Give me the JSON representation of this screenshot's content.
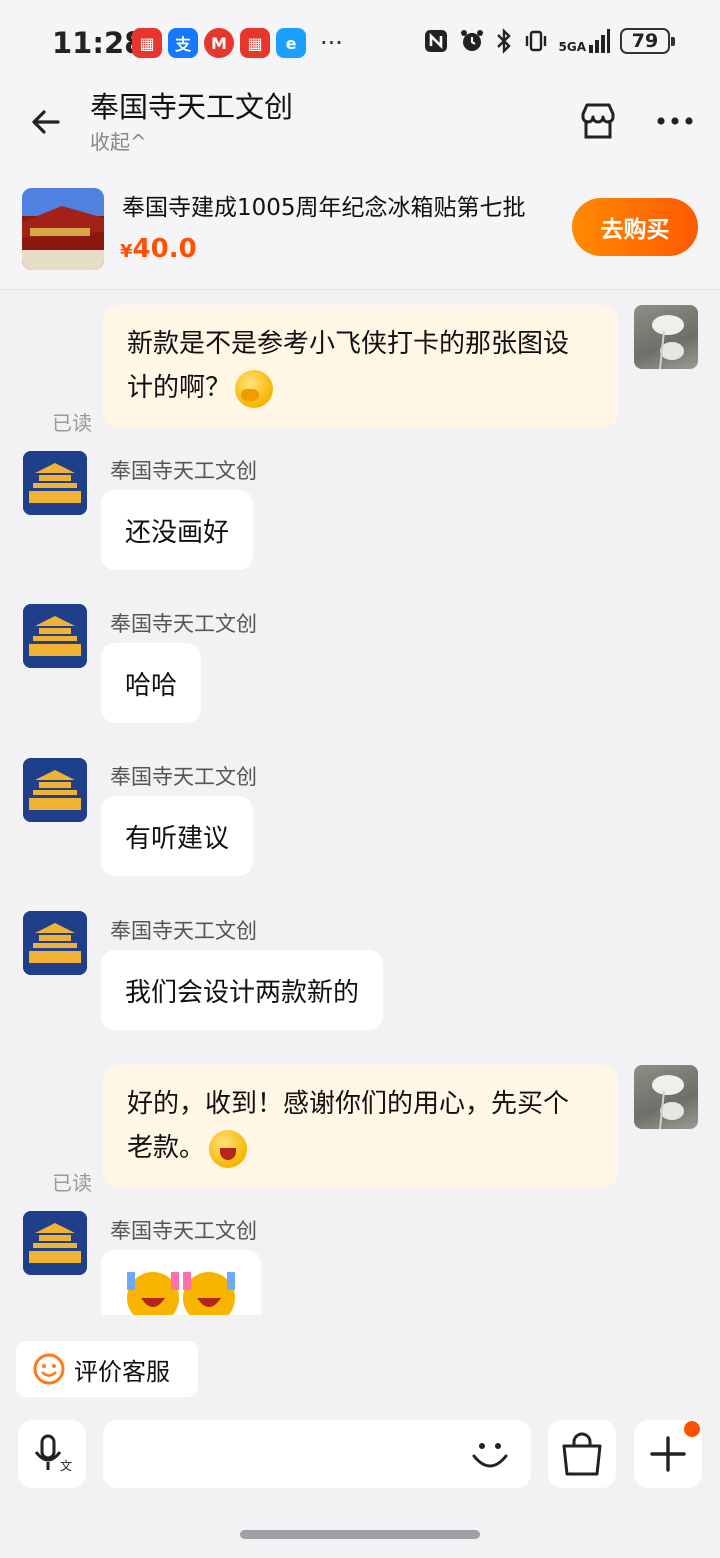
{
  "status": {
    "time": "11:28",
    "network": "5GA",
    "battery": "79",
    "more": "···"
  },
  "header": {
    "title": "奉国寺天工文创",
    "collapse": "收起^"
  },
  "product": {
    "name": "奉国寺建成1005周年纪念冰箱贴第七批",
    "currency": "¥",
    "price": "40.0",
    "buy": "去购买"
  },
  "messages": [
    {
      "from": "user",
      "text": "新款是不是参考小飞侠打卡的那张图设计的啊？",
      "read": "已读"
    },
    {
      "from": "shop",
      "sender": "奉国寺天工文创",
      "text": "还没画好"
    },
    {
      "from": "shop",
      "sender": "奉国寺天工文创",
      "text": "哈哈"
    },
    {
      "from": "shop",
      "sender": "奉国寺天工文创",
      "text": "有听建议"
    },
    {
      "from": "shop",
      "sender": "奉国寺天工文创",
      "text": "我们会设计两款新的"
    },
    {
      "from": "user",
      "text": "好的，收到！感谢你们的用心，先买个老款。",
      "read": "已读"
    },
    {
      "from": "shop",
      "sender": "奉国寺天工文创",
      "text": ""
    }
  ],
  "bottom": {
    "rate": "评价客服"
  },
  "colors": {
    "accent": "#ff5000",
    "user_bubble": "#fff6e6"
  }
}
